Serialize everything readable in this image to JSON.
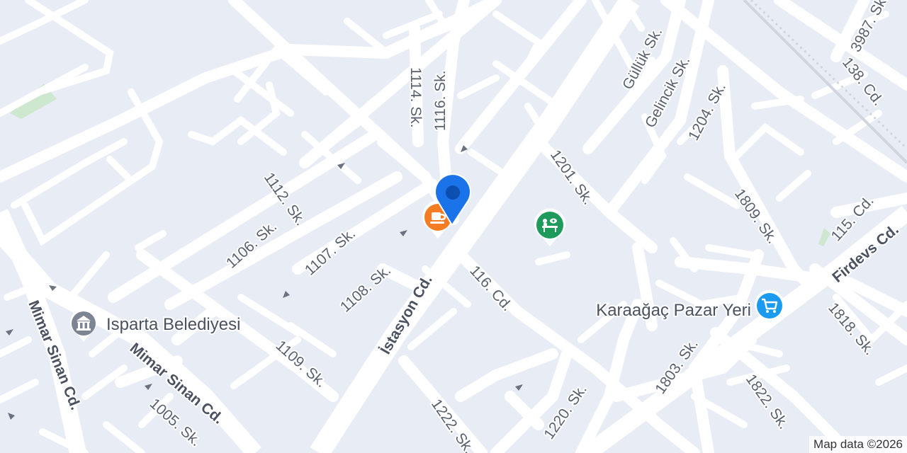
{
  "map": {
    "attribution": "Map data ©2026",
    "pois": {
      "city_hall": "Isparta Belediyesi",
      "market": "Karaağaç Pazar Yeri"
    },
    "icons": {
      "location_pin": "location-pin-icon",
      "cafe": "cafe-icon",
      "city_hall": "city-hall-icon",
      "park": "park-icon",
      "shopping": "shopping-cart-icon"
    },
    "colors": {
      "background": "#e8ecf5",
      "road": "#ffffff",
      "pin": "#1a73e8",
      "cafe": "#f57c22",
      "park": "#1e9a5b",
      "shop": "#1a9bf0",
      "gov": "#7d8593",
      "green_area": "#cde8cf"
    },
    "streets": {
      "s1114": "1114. Sk.",
      "s1116": "1116. Sk.",
      "gulluk": "Güllük Sk.",
      "gelincik": "Gelincik Sk.",
      "s1204": "1204. Sk.",
      "s3987": "3987. Sk.",
      "c138": "138. Cd.",
      "s1201": "1201. Sk.",
      "s1112": "1112. Sk.",
      "s1106": "1106. Sk.",
      "s1107": "1107. Sk.",
      "s1108": "1108. Sk.",
      "istasyon": "İstasyon Cd.",
      "c116": "116. Cd.",
      "s1809": "1809. Sk.",
      "c115": "115. Cd.",
      "firdevs": "Firdevs Cd.",
      "s1818": "1818. Sk.",
      "mimar_sinan_v": "Mimar Sinan Cd.",
      "mimar_sinan_d": "Mimar Sinan Cd.",
      "s1109": "1109. Sk.",
      "s1005": "1005. Sk.",
      "s1222": "1222. Sk.",
      "s1220": "1220. Sk.",
      "s1803": "1803. Sk.",
      "s1822": "1822. Sk."
    }
  }
}
